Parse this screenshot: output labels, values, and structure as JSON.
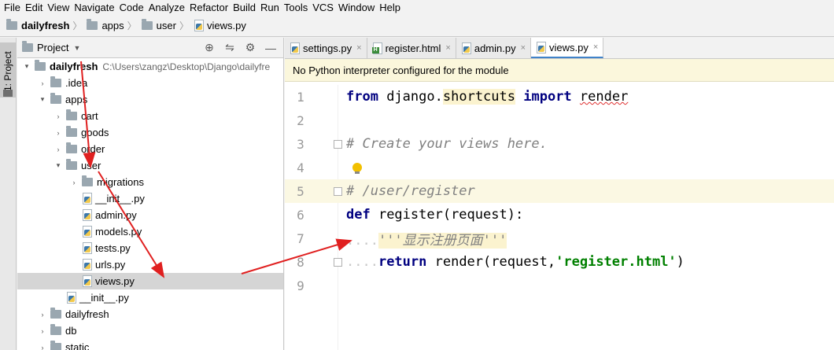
{
  "menu": [
    "File",
    "Edit",
    "View",
    "Navigate",
    "Code",
    "Analyze",
    "Refactor",
    "Build",
    "Run",
    "Tools",
    "VCS",
    "Window",
    "Help"
  ],
  "breadcrumb": [
    "dailyfresh",
    "apps",
    "user",
    "views.py"
  ],
  "left_stripe": {
    "label": "1: Project"
  },
  "project_panel": {
    "title": "Project"
  },
  "tree": [
    {
      "label": "dailyfresh",
      "path": "C:\\Users\\zangz\\Desktop\\Django\\dailyfre",
      "arrow": "▾",
      "icon": "folder-icon",
      "depth": 0
    },
    {
      "label": ".idea",
      "arrow": "›",
      "icon": "folder-icon",
      "depth": 1
    },
    {
      "label": "apps",
      "arrow": "▾",
      "icon": "folder-icon",
      "depth": 1
    },
    {
      "label": "cart",
      "arrow": "›",
      "icon": "folder-icon",
      "depth": 2
    },
    {
      "label": "goods",
      "arrow": "›",
      "icon": "folder-icon",
      "depth": 2
    },
    {
      "label": "order",
      "arrow": "›",
      "icon": "folder-icon",
      "depth": 2
    },
    {
      "label": "user",
      "arrow": "▾",
      "icon": "folder-icon",
      "depth": 2
    },
    {
      "label": "migrations",
      "arrow": "›",
      "icon": "folder-icon",
      "depth": 3
    },
    {
      "label": "__init__.py",
      "arrow": "",
      "icon": "python-file-icon",
      "depth": 3
    },
    {
      "label": "admin.py",
      "arrow": "",
      "icon": "python-file-icon",
      "depth": 3
    },
    {
      "label": "models.py",
      "arrow": "",
      "icon": "python-file-icon",
      "depth": 3
    },
    {
      "label": "tests.py",
      "arrow": "",
      "icon": "python-file-icon",
      "depth": 3
    },
    {
      "label": "urls.py",
      "arrow": "",
      "icon": "python-file-icon",
      "depth": 3
    },
    {
      "label": "views.py",
      "arrow": "",
      "icon": "python-file-icon",
      "depth": 3,
      "selected": true
    },
    {
      "label": "__init__.py",
      "arrow": "",
      "icon": "python-file-icon",
      "depth": 2
    },
    {
      "label": "dailyfresh",
      "arrow": "›",
      "icon": "folder-icon",
      "depth": 1
    },
    {
      "label": "db",
      "arrow": "›",
      "icon": "folder-icon",
      "depth": 1
    },
    {
      "label": "static",
      "arrow": "›",
      "icon": "folder-icon",
      "depth": 1
    }
  ],
  "tabs": [
    {
      "label": "settings.py",
      "icon": "python-file-icon",
      "active": false
    },
    {
      "label": "register.html",
      "icon": "html-file-icon",
      "active": false
    },
    {
      "label": "admin.py",
      "icon": "python-file-icon",
      "active": false
    },
    {
      "label": "views.py",
      "icon": "python-file-icon",
      "active": true
    }
  ],
  "notice": "No Python interpreter configured for the module",
  "code": {
    "line_numbers": [
      "1",
      "2",
      "3",
      "4",
      "5",
      "6",
      "7",
      "8",
      "9"
    ],
    "l1": {
      "from": "from",
      "module": "django",
      "dot": ".",
      "sub": "shortcuts",
      "import": "import",
      "name": "render"
    },
    "l3": "# Create your views here.",
    "l5": "# /user/register",
    "l6": {
      "def": "def",
      "rest": " register(request):"
    },
    "l7": {
      "indent": "....",
      "doc": "'''显示注册页面'''"
    },
    "l8": {
      "indent": "....",
      "ret": "return",
      "mid": " render(request,",
      "str": "'register.html'",
      "end": ")"
    }
  },
  "colors": {
    "keyword": "#000080",
    "string": "#008000",
    "comment": "#808080",
    "arrow": "#e02020",
    "selection": "#d5d5d5"
  }
}
